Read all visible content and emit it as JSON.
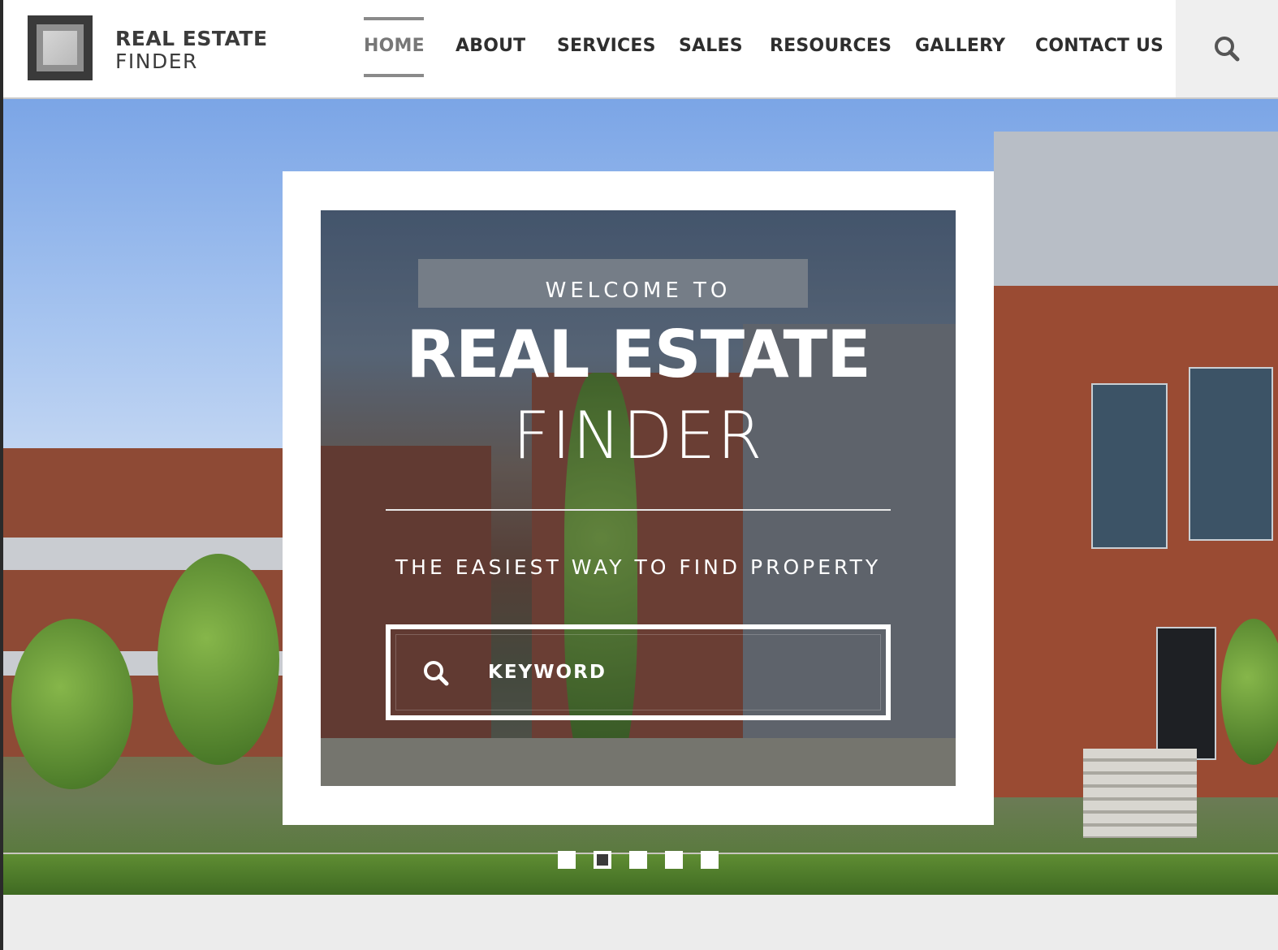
{
  "brand": {
    "line1": "REAL ESTATE",
    "line2": "FINDER",
    "logo_icon": "square-frame-logo"
  },
  "nav": {
    "items": [
      {
        "label": "HOME",
        "active": true
      },
      {
        "label": "ABOUT",
        "active": false
      },
      {
        "label": "SERVICES",
        "active": false
      },
      {
        "label": "SALES",
        "active": false
      },
      {
        "label": "RESOURCES",
        "active": false
      },
      {
        "label": "GALLERY",
        "active": false
      },
      {
        "label": "CONTACT US",
        "active": false
      }
    ],
    "search_icon": "search-icon"
  },
  "hero": {
    "welcome": "WELCOME TO",
    "title_main": "REAL ESTATE",
    "title_sub": "FINDER",
    "tagline": "THE EASIEST WAY TO FIND PROPERTY",
    "search_placeholder": "KEYWORD",
    "slides_count": 5,
    "active_slide": 2
  },
  "colors": {
    "header_bg": "#ffffff",
    "nav_text": "#2e2e2e",
    "nav_active": "#777777",
    "page_bg": "#ececec"
  }
}
